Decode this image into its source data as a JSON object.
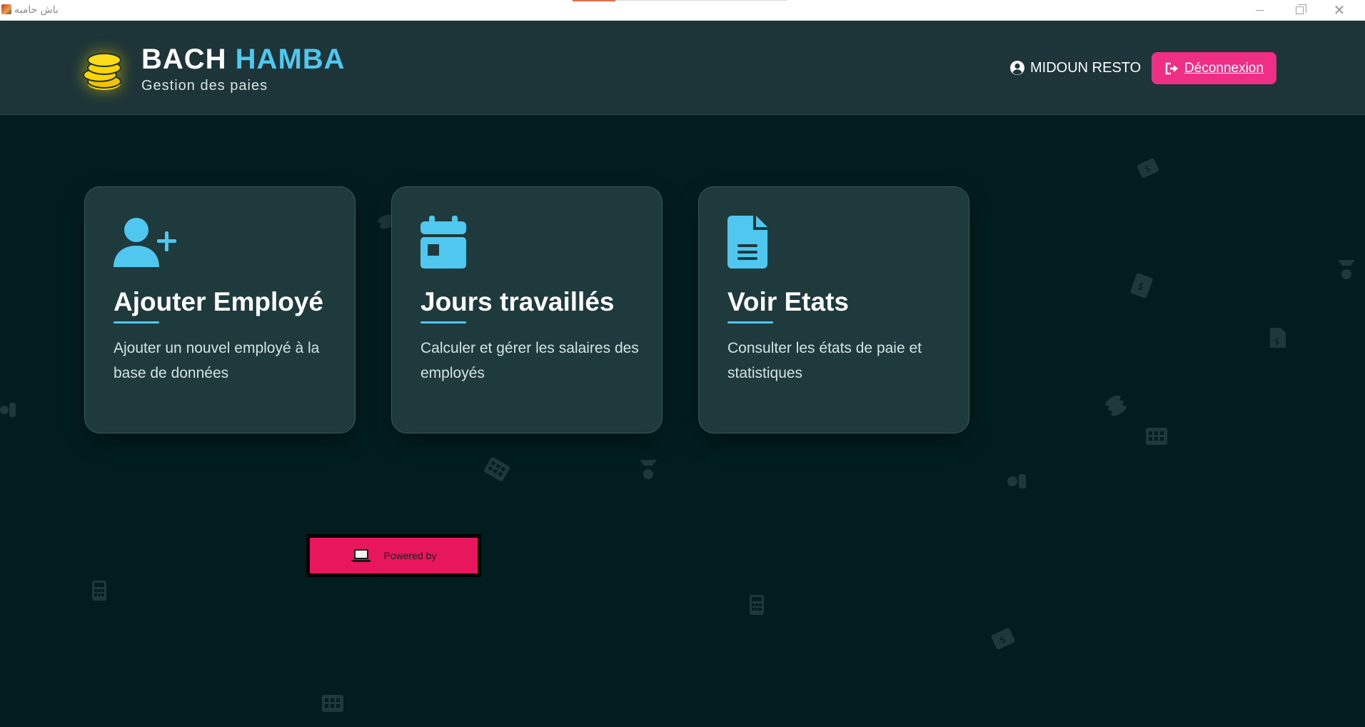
{
  "window": {
    "title": "باش حامبه"
  },
  "header": {
    "brand_word1": "BACH",
    "brand_word2": "HAMBA",
    "subtitle": "Gestion des paies",
    "user_name": "MIDOUN RESTO",
    "logout_label": "Déconnexion"
  },
  "cards": [
    {
      "icon": "user-plus-icon",
      "title": "Ajouter Employé",
      "description": "Ajouter un nouvel employé à la base de données"
    },
    {
      "icon": "calendar-icon",
      "title": "Jours travaillés",
      "description": "Calculer et gérer les salaires des employés"
    },
    {
      "icon": "document-icon",
      "title": "Voir Etats",
      "description": "Consulter les états de paie et statistiques"
    }
  ],
  "footer": {
    "powered_label": "Powered by",
    "powered_icon": "laptop-icon"
  },
  "colors": {
    "background": "#021d20",
    "header": "#1d3538",
    "card": "#1e3a3c",
    "accent_blue": "#4fc7ee",
    "accent_pink": "#ef2e86",
    "powered_red": "#e8175d",
    "logo_gold": "#ffd400"
  }
}
